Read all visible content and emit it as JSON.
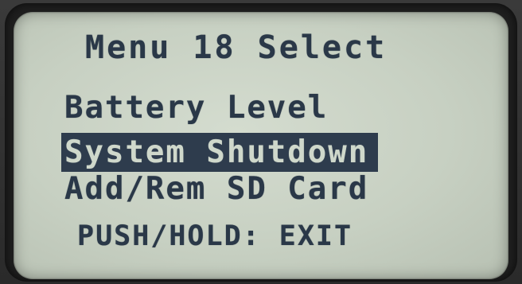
{
  "screen": {
    "title": "Menu 18 Select",
    "menu_items": [
      {
        "label": "Battery Level",
        "selected": false
      },
      {
        "label": "System Shutdown",
        "selected": true
      },
      {
        "label": "Add/Rem SD Card",
        "selected": false
      }
    ],
    "footer_hint": "PUSH/HOLD: EXIT"
  },
  "colors": {
    "lcd_background": "#c7d0c2",
    "text": "#2a3848",
    "highlight": "#2e3c4d",
    "highlight_text": "#cfd8cb"
  }
}
